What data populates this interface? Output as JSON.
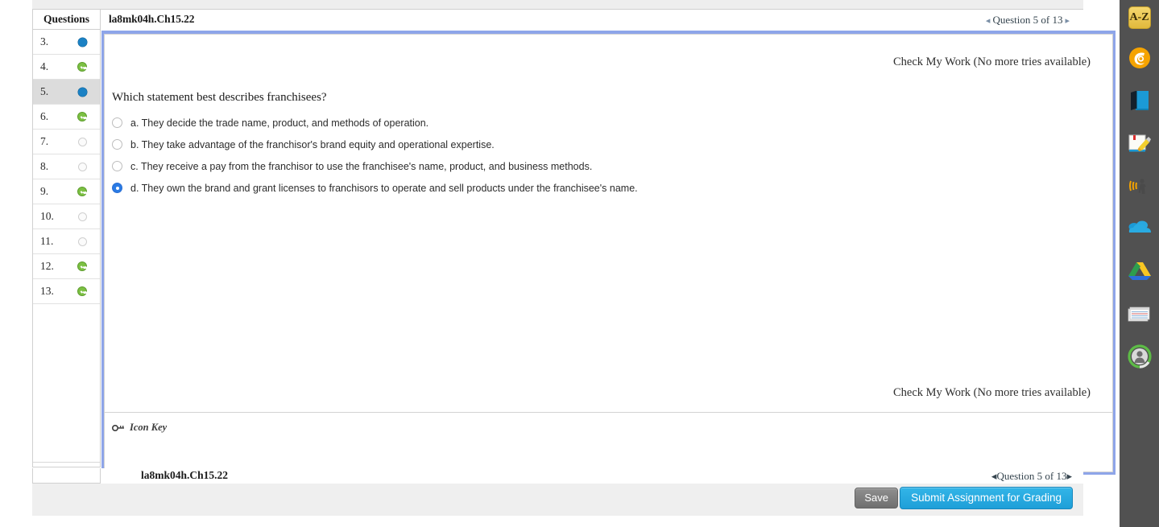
{
  "window": {
    "bg_color": "#ffffff",
    "toolbar_bg": "#515151",
    "action_bar_bg": "#efefef",
    "frame_border_color": "#8ea5e9"
  },
  "panel": {
    "questions_header": "Questions",
    "assignment_title": "la8mk04h.Ch15.22",
    "pager": {
      "prev_arrow": "◂",
      "label": "Question 5 of 13",
      "next_arrow": "▸"
    },
    "footer": {
      "assignment_title": "la8mk04h.Ch15.22",
      "pager": {
        "prev_arrow": "◂",
        "label": "Question 5 of 13",
        "next_arrow": "▸"
      }
    },
    "question_rows": [
      {
        "num": "3.",
        "status": "in-progress",
        "active": false
      },
      {
        "num": "4.",
        "status": "complete",
        "active": false
      },
      {
        "num": "5.",
        "status": "in-progress",
        "active": true
      },
      {
        "num": "6.",
        "status": "complete",
        "active": false
      },
      {
        "num": "7.",
        "status": "empty",
        "active": false
      },
      {
        "num": "8.",
        "status": "empty",
        "active": false
      },
      {
        "num": "9.",
        "status": "complete",
        "active": false
      },
      {
        "num": "10.",
        "status": "empty",
        "active": false
      },
      {
        "num": "11.",
        "status": "empty",
        "active": false
      },
      {
        "num": "12.",
        "status": "complete",
        "active": false
      },
      {
        "num": "13.",
        "status": "complete",
        "active": false
      }
    ],
    "status_colors": {
      "in-progress": "#1b81c4",
      "complete": "#7cc043",
      "empty": "#fbfbfb"
    }
  },
  "content": {
    "check_my_work_top": "Check My Work (No more tries available)",
    "check_my_work_bottom": "Check My Work (No more tries available)",
    "question_text": "Which statement best describes franchisees?",
    "options": [
      {
        "label": "a. They decide the trade name, product, and methods of operation.",
        "selected": false
      },
      {
        "label": "b. They take advantage of the franchisor's brand equity and operational expertise.",
        "selected": false
      },
      {
        "label": "c. They receive a pay from the franchisor to use the franchisee's name, product, and business methods.",
        "selected": false
      },
      {
        "label": "d. They own the brand and grant licenses to franchisors to operate and sell products under the franchisee's name.",
        "selected": true
      }
    ],
    "selected_option": "d",
    "icon_key_label": "Icon Key",
    "icon_key_icon": "key-icon"
  },
  "actions": {
    "save_label": "Save",
    "submit_label": "Submit Assignment for Grading",
    "save_color": "#7b7b7b",
    "submit_color": "#22a3da"
  },
  "toolbar": {
    "items": [
      {
        "name": "dictionary-az-icon",
        "glyph": "A-Z",
        "tooltip": "A-Z"
      },
      {
        "name": "cengage-logo-icon",
        "glyph": "",
        "tooltip": ""
      },
      {
        "name": "ebook-icon",
        "glyph": "",
        "tooltip": ""
      },
      {
        "name": "highlighter-notes-icon",
        "glyph": "",
        "tooltip": ""
      },
      {
        "name": "read-aloud-icon",
        "glyph": "",
        "tooltip": ""
      },
      {
        "name": "onedrive-icon",
        "glyph": "",
        "tooltip": ""
      },
      {
        "name": "google-drive-icon",
        "glyph": "",
        "tooltip": ""
      },
      {
        "name": "flashcards-icon",
        "glyph": "",
        "tooltip": ""
      },
      {
        "name": "user-profile-avatar",
        "glyph": "",
        "tooltip": ""
      }
    ]
  }
}
